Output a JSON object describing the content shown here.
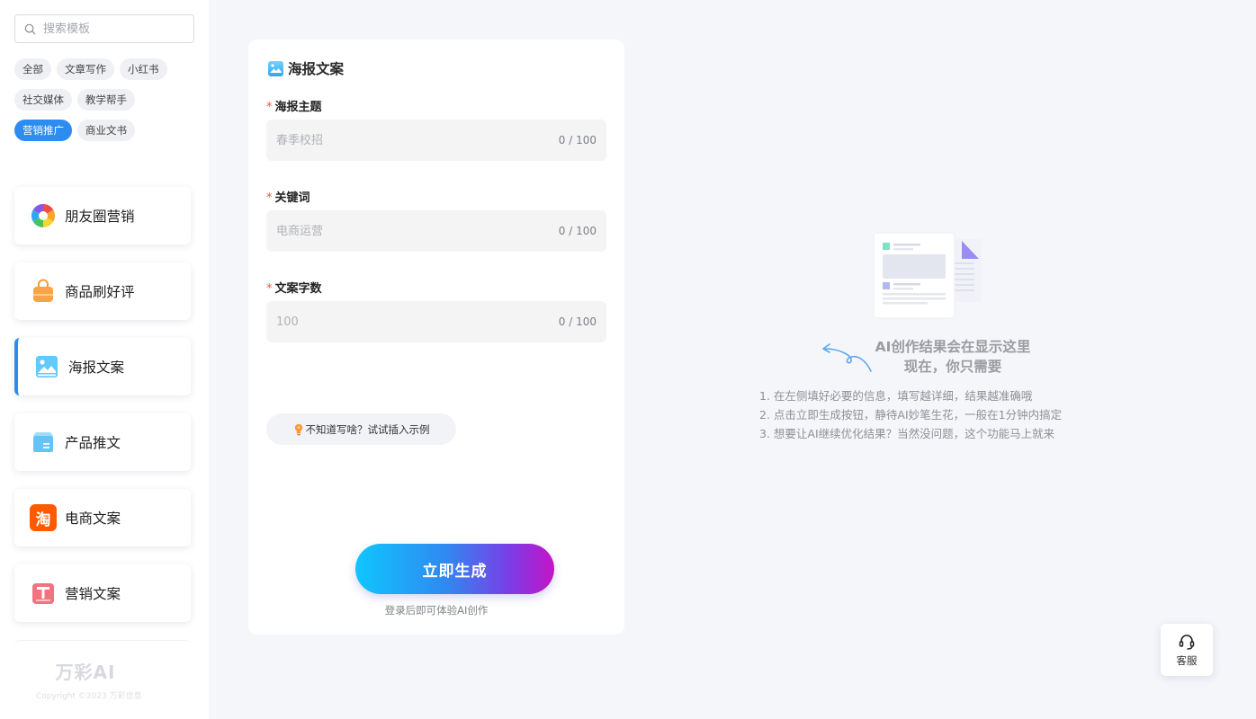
{
  "sidebar": {
    "search_placeholder": "搜索模板",
    "tag_rows": [
      [
        "全部",
        "文章写作",
        "小红书"
      ],
      [
        "社交媒体",
        "教学帮手"
      ],
      [
        "营销推广",
        "商业文书"
      ]
    ],
    "active_tag": "营销推广",
    "templates": [
      {
        "label": "朋友圈营销",
        "icon": "aperture-icon"
      },
      {
        "label": "商品刷好评",
        "icon": "shopping-bag-icon"
      },
      {
        "label": "海报文案",
        "icon": "poster-image-icon",
        "selected": true
      },
      {
        "label": "产品推文",
        "icon": "product-box-icon"
      },
      {
        "label": "电商文案",
        "icon": "taobao-icon"
      },
      {
        "label": "营销文案",
        "icon": "marketing-t-icon"
      }
    ],
    "brand_logo": "万彩AI",
    "copyright": "Copyright ©2023 万彩信息"
  },
  "form": {
    "title": "海报文案",
    "fields": [
      {
        "label": "海报主题",
        "placeholder": "春季校招",
        "count": "0 / 100"
      },
      {
        "label": "关键词",
        "placeholder": "电商运营",
        "count": "0 / 100"
      },
      {
        "label": "文案字数",
        "placeholder": "100",
        "count": "0 / 100"
      }
    ],
    "required_mark": "*",
    "hint_button": "不知道写啥？试试插入示例",
    "generate_button": "立即生成",
    "login_tip": "登录后即可体验AI创作"
  },
  "result": {
    "title_line1": "AI创作结果会在显示这里",
    "title_line2": "现在，你只需要",
    "steps": [
      "1. 在左侧填好必要的信息，填写越详细，结果越准确哦",
      "2. 点击立即生成按钮，静待AI妙笔生花，一般在1分钟内搞定",
      "3. 想要让AI继续优化结果？当然没问题，这个功能马上就来"
    ]
  },
  "service": {
    "label": "客服"
  },
  "colors": {
    "accent": "#2d8cf0",
    "required": "#f5533d",
    "background": "#f5f6fa"
  }
}
